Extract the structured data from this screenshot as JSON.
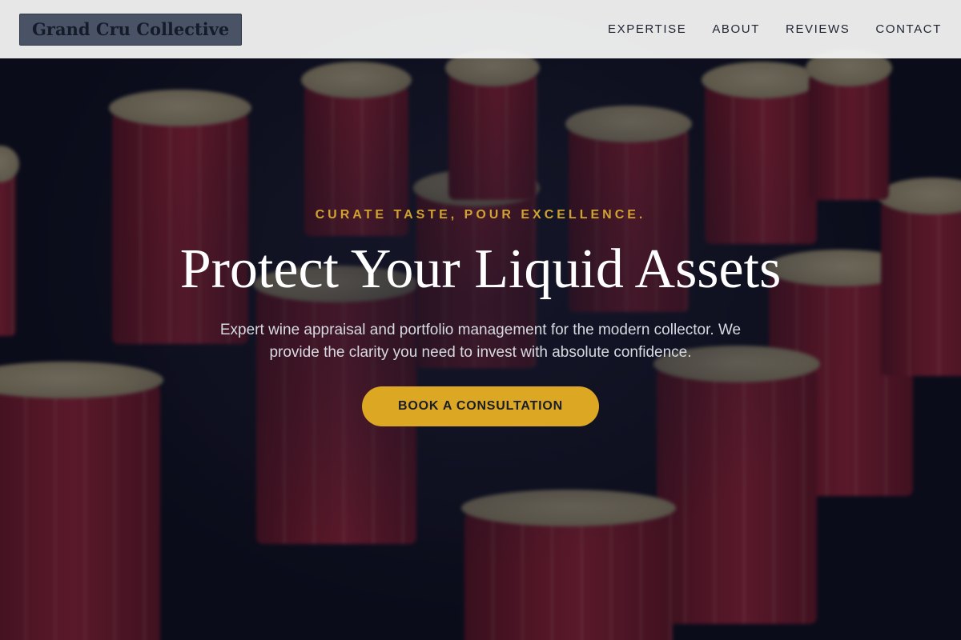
{
  "header": {
    "logo_text": "Grand Cru Collective",
    "nav": [
      {
        "label": "EXPERTISE"
      },
      {
        "label": "ABOUT"
      },
      {
        "label": "REVIEWS"
      },
      {
        "label": "CONTACT"
      }
    ]
  },
  "hero": {
    "eyebrow": "CURATE TASTE, POUR EXCELLENCE.",
    "headline": "Protect Your Liquid Assets",
    "subtext": "Expert wine appraisal and portfolio management for the modern collector. We provide the clarity you need to invest with absolute confidence.",
    "cta_label": "BOOK A CONSULTATION"
  },
  "colors": {
    "accent": "#dca823",
    "eyebrow": "#d1a22f",
    "header_bg": "#f5f5f5",
    "logo_bg": "#4a5366",
    "capsule_red": "#8a1f2e"
  }
}
